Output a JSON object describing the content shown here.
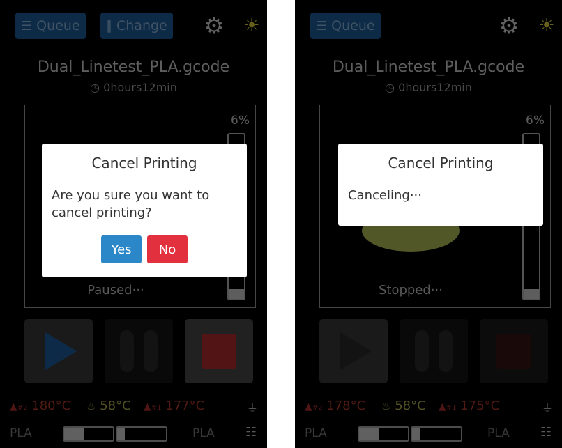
{
  "screens": [
    {
      "topbar": {
        "queue_label": "Queue",
        "change_label": "Change",
        "show_change": true
      },
      "job": {
        "filename": "Dual_Linetest_PLA.gcode",
        "duration": "0hours12min"
      },
      "preview": {
        "progress_text": "6%",
        "progress_fraction": 0.06,
        "status": "Paused···",
        "show_model": false
      },
      "controls": [
        "play",
        "pause",
        "stop"
      ],
      "temps": {
        "nozzle2_label": "#2",
        "nozzle2_temp": "180°C",
        "bed_temp": "58°C",
        "nozzle1_label": "#1",
        "nozzle1_temp": "177°C"
      },
      "materials": {
        "left": "PLA",
        "right": "PLA"
      },
      "dialog": {
        "title": "Cancel Printing",
        "message": "Are you sure you want to cancel printing?",
        "yes_label": "Yes",
        "no_label": "No",
        "has_buttons": true
      }
    },
    {
      "topbar": {
        "queue_label": "Queue",
        "change_label": "",
        "show_change": false
      },
      "job": {
        "filename": "Dual_Linetest_PLA.gcode",
        "duration": "0hours12min"
      },
      "preview": {
        "progress_text": "6%",
        "progress_fraction": 0.06,
        "status": "Stopped···",
        "show_model": true
      },
      "controls": [
        "play",
        "pause",
        "stop"
      ],
      "temps": {
        "nozzle2_label": "#2",
        "nozzle2_temp": "178°C",
        "bed_temp": "58°C",
        "nozzle1_label": "#1",
        "nozzle1_temp": "175°C"
      },
      "materials": {
        "left": "PLA",
        "right": "PLA"
      },
      "dialog": {
        "title": "Cancel Printing",
        "message": "Canceling···",
        "yes_label": "",
        "no_label": "",
        "has_buttons": false
      }
    }
  ],
  "icons": {
    "queue": "list-icon",
    "change": "filament-change-icon",
    "settings": "gear-icon",
    "light": "lightbulb-icon",
    "nozzle": "nozzle-icon",
    "bed": "heated-bed-icon",
    "power": "power-plug-icon",
    "network": "network-icon"
  },
  "colors": {
    "accent_blue": "#1e5f9e",
    "yes_button": "#2b87c7",
    "no_button": "#e2303f",
    "nozzle_temp": "#b33a2a",
    "bed_temp": "#b4b24a",
    "model": "#b6c15a"
  }
}
